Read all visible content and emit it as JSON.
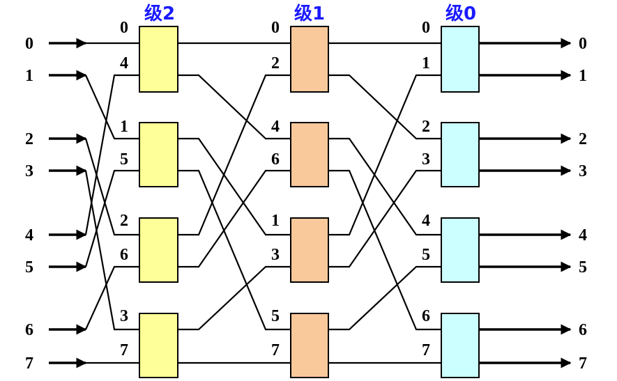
{
  "colors": {
    "stage2_box": "#ffff99",
    "stage1_box": "#f9c89b",
    "stage0_box": "#ccffff",
    "stage_title": "#1a1aff",
    "line": "#000000"
  },
  "inputs": [
    "0",
    "1",
    "2",
    "3",
    "4",
    "5",
    "6",
    "7"
  ],
  "outputs": [
    "0",
    "1",
    "2",
    "3",
    "4",
    "5",
    "6",
    "7"
  ],
  "stages": [
    {
      "title": "级2",
      "switches": [
        [
          "0",
          "4"
        ],
        [
          "1",
          "5"
        ],
        [
          "2",
          "6"
        ],
        [
          "3",
          "7"
        ]
      ]
    },
    {
      "title": "级1",
      "switches": [
        [
          "0",
          "2"
        ],
        [
          "4",
          "6"
        ],
        [
          "1",
          "3"
        ],
        [
          "5",
          "7"
        ]
      ]
    },
    {
      "title": "级0",
      "switches": [
        [
          "0",
          "1"
        ],
        [
          "2",
          "3"
        ],
        [
          "4",
          "5"
        ],
        [
          "6",
          "7"
        ]
      ]
    }
  ]
}
